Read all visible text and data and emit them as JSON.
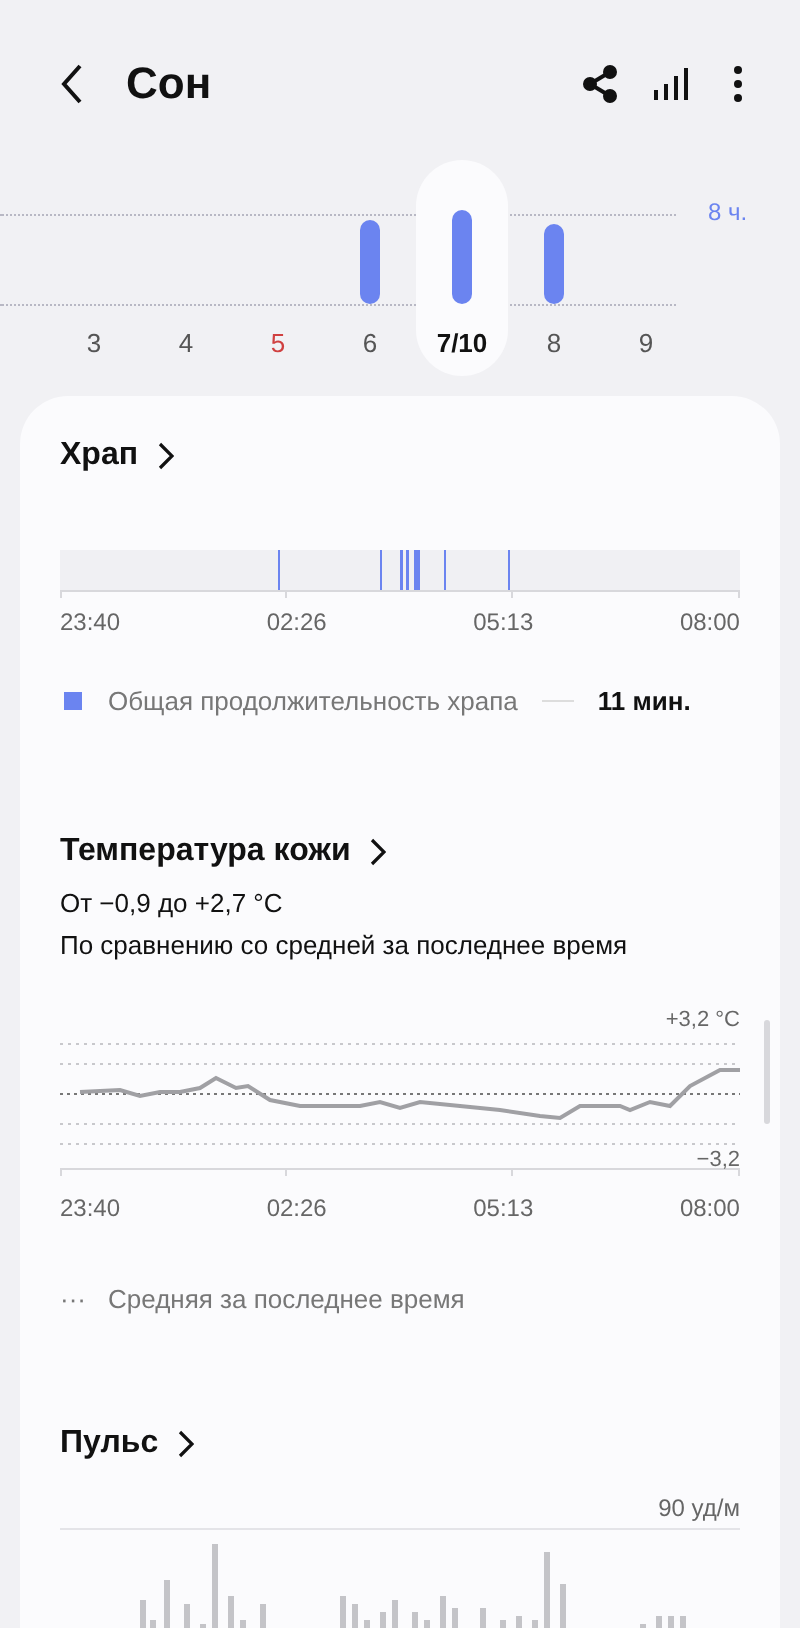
{
  "header": {
    "title": "Сон"
  },
  "sleep_days": {
    "goal_label": "8 ч.",
    "days": [
      {
        "label": "3",
        "selected": false,
        "weekend": false
      },
      {
        "label": "4",
        "selected": false,
        "weekend": false
      },
      {
        "label": "5",
        "selected": false,
        "weekend": true
      },
      {
        "label": "6",
        "selected": false,
        "weekend": false,
        "kind": "bar"
      },
      {
        "label": "7/10",
        "selected": true,
        "weekend": false,
        "kind": "bar"
      },
      {
        "label": "8",
        "selected": false,
        "weekend": false,
        "kind": "bar"
      },
      {
        "label": "9",
        "selected": false,
        "weekend": false,
        "kind": "none"
      }
    ]
  },
  "snoring": {
    "title": "Храп",
    "time_labels": [
      "23:40",
      "02:26",
      "05:13",
      "08:00"
    ],
    "legend": {
      "label": "Общая продолжительность храпа",
      "value": "11 мин."
    }
  },
  "skin_temperature": {
    "title": "Температура кожи",
    "range": "От −0,9 до +2,7 °C",
    "subtitle": "По сравнению со средней за последнее время",
    "y_top": "+3,2 °C",
    "y_bottom": "−3,2",
    "time_labels": [
      "23:40",
      "02:26",
      "05:13",
      "08:00"
    ],
    "legend": {
      "symbol": "···",
      "label": "Средняя за последнее время"
    }
  },
  "pulse": {
    "title": "Пульс",
    "y_top": "90 уд/м"
  }
}
